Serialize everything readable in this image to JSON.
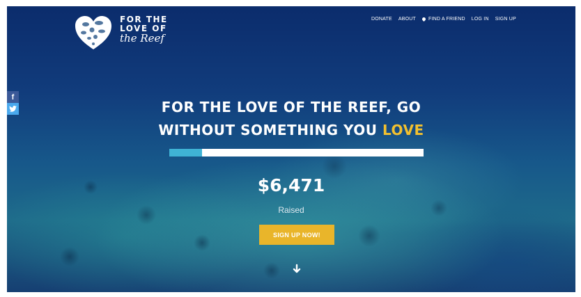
{
  "brand": {
    "line1": "FOR THE",
    "line2": "LOVE OF",
    "script": "the Reef"
  },
  "nav": {
    "items": [
      "DONATE",
      "ABOUT",
      "FIND A FRIEND",
      "LOG IN",
      "SIGN UP"
    ],
    "find_a_friend_icon": "map-pin-icon"
  },
  "social": {
    "facebook_glyph": "f",
    "twitter_icon": "twitter-icon"
  },
  "hero": {
    "headline_line1": "FOR THE LOVE OF THE REEF, GO",
    "headline_line2_prefix": "WITHOUT SOMETHING YOU ",
    "headline_line2_highlight": "LOVE",
    "progress_fraction": 0.13,
    "amount": "$6,471",
    "raised_label": "Raised",
    "cta_label": "SIGN UP NOW!",
    "scroll_icon": "arrow-down-icon"
  },
  "colors": {
    "accent": "#f2c02f",
    "cta": "#e9b52a",
    "progress_fill": "#3fb3d5",
    "facebook": "#3b5998",
    "twitter": "#4aa9ee"
  }
}
